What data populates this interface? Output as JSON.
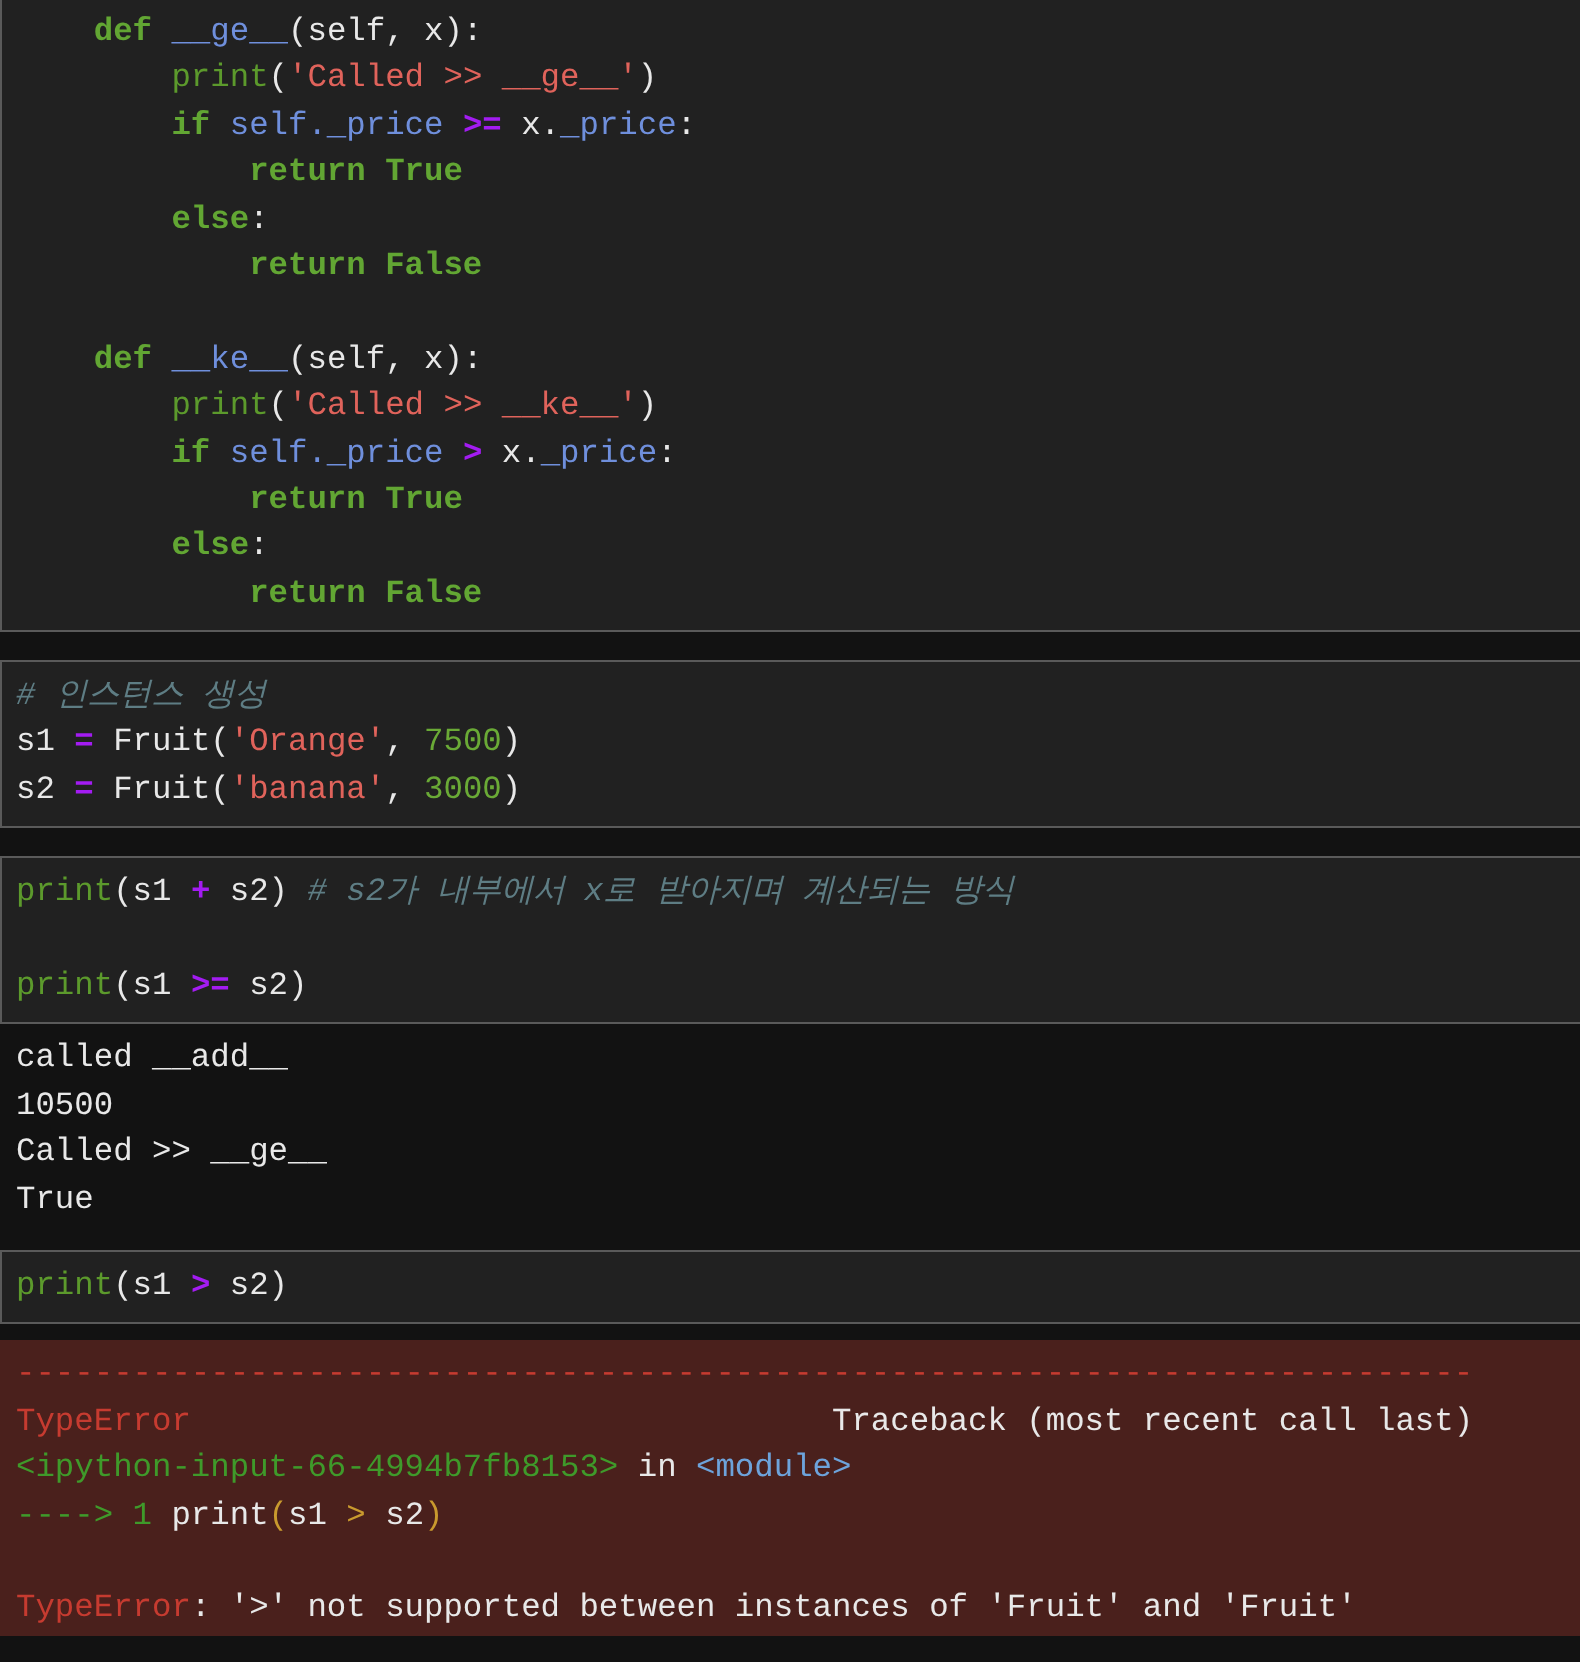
{
  "cells": [
    {
      "kind": "code",
      "lines": [
        {
          "tokens": [
            {
              "text": "    def ",
              "kind": "keyword"
            },
            {
              "text": "__ge__",
              "kind": "name"
            },
            {
              "text": "(self, x):",
              "kind": "plain"
            }
          ]
        },
        {
          "tokens": [
            {
              "text": "        print",
              "kind": "builtin"
            },
            {
              "text": "(",
              "kind": "plain"
            },
            {
              "text": "'Called >> __ge__'",
              "kind": "string"
            },
            {
              "text": ")",
              "kind": "plain"
            }
          ]
        },
        {
          "tokens": [
            {
              "text": "        if ",
              "kind": "keyword"
            },
            {
              "text": "self._price ",
              "kind": "name"
            },
            {
              "text": ">=",
              "kind": "operator"
            },
            {
              "text": " x.",
              "kind": "plain"
            },
            {
              "text": "_price",
              "kind": "name"
            },
            {
              "text": ":",
              "kind": "plain"
            }
          ]
        },
        {
          "tokens": [
            {
              "text": "            return True",
              "kind": "keyword"
            }
          ]
        },
        {
          "tokens": [
            {
              "text": "        else",
              "kind": "keyword"
            },
            {
              "text": ":",
              "kind": "plain"
            }
          ]
        },
        {
          "tokens": [
            {
              "text": "            return False",
              "kind": "keyword"
            }
          ]
        },
        {
          "space_above": true,
          "tokens": [
            {
              "text": "    def ",
              "kind": "keyword"
            },
            {
              "text": "__ke__",
              "kind": "name"
            },
            {
              "text": "(self, x):",
              "kind": "plain"
            }
          ]
        },
        {
          "tokens": [
            {
              "text": "        print",
              "kind": "builtin"
            },
            {
              "text": "(",
              "kind": "plain"
            },
            {
              "text": "'Called >> __ke__'",
              "kind": "string"
            },
            {
              "text": ")",
              "kind": "plain"
            }
          ]
        },
        {
          "tokens": [
            {
              "text": "        if ",
              "kind": "keyword"
            },
            {
              "text": "self._price ",
              "kind": "name"
            },
            {
              "text": ">",
              "kind": "operator"
            },
            {
              "text": " x.",
              "kind": "plain"
            },
            {
              "text": "_price",
              "kind": "name"
            },
            {
              "text": ":",
              "kind": "plain"
            }
          ]
        },
        {
          "tokens": [
            {
              "text": "            return True",
              "kind": "keyword"
            }
          ]
        },
        {
          "tokens": [
            {
              "text": "        else",
              "kind": "keyword"
            },
            {
              "text": ":",
              "kind": "plain"
            }
          ]
        },
        {
          "tokens": [
            {
              "text": "            return False",
              "kind": "keyword"
            }
          ]
        }
      ]
    },
    {
      "kind": "code",
      "lines": [
        {
          "tokens": [
            {
              "text": "# 인스턴스 생성",
              "kind": "comment"
            }
          ]
        },
        {
          "tokens": [
            {
              "text": "s1 ",
              "kind": "plain"
            },
            {
              "text": "=",
              "kind": "operator"
            },
            {
              "text": " Fruit(",
              "kind": "plain"
            },
            {
              "text": "'Orange'",
              "kind": "string"
            },
            {
              "text": ", ",
              "kind": "plain"
            },
            {
              "text": "7500",
              "kind": "number"
            },
            {
              "text": ")",
              "kind": "plain"
            }
          ]
        },
        {
          "tokens": [
            {
              "text": "s2 ",
              "kind": "plain"
            },
            {
              "text": "=",
              "kind": "operator"
            },
            {
              "text": " Fruit(",
              "kind": "plain"
            },
            {
              "text": "'banana'",
              "kind": "string"
            },
            {
              "text": ", ",
              "kind": "plain"
            },
            {
              "text": "3000",
              "kind": "number"
            },
            {
              "text": ")",
              "kind": "plain"
            }
          ]
        }
      ]
    },
    {
      "kind": "code",
      "lines": [
        {
          "tokens": [
            {
              "text": "print",
              "kind": "builtin"
            },
            {
              "text": "(s1 ",
              "kind": "plain"
            },
            {
              "text": "+",
              "kind": "operator"
            },
            {
              "text": " s2) ",
              "kind": "plain"
            },
            {
              "text": "# s2가 내부에서 x로 받아지며 계산되는 방식",
              "kind": "comment"
            }
          ]
        },
        {
          "space_above": true,
          "tokens": [
            {
              "text": "print",
              "kind": "builtin"
            },
            {
              "text": "(s1 ",
              "kind": "plain"
            },
            {
              "text": ">=",
              "kind": "operator"
            },
            {
              "text": " s2)",
              "kind": "plain"
            }
          ]
        }
      ],
      "outputs": [
        {
          "kind": "stream",
          "lines": [
            {
              "tokens": [
                {
                  "text": "called __add__",
                  "kind": "plain"
                }
              ]
            },
            {
              "tokens": [
                {
                  "text": "10500",
                  "kind": "plain"
                }
              ]
            },
            {
              "tokens": [
                {
                  "text": "Called >> __ge__",
                  "kind": "plain"
                }
              ]
            },
            {
              "tokens": [
                {
                  "text": "True",
                  "kind": "plain"
                }
              ]
            }
          ]
        }
      ]
    },
    {
      "kind": "code",
      "lines": [
        {
          "tokens": [
            {
              "text": "print",
              "kind": "builtin"
            },
            {
              "text": "(s1 ",
              "kind": "plain"
            },
            {
              "text": ">",
              "kind": "operator"
            },
            {
              "text": " s2)",
              "kind": "plain"
            }
          ]
        }
      ],
      "outputs": [
        {
          "kind": "error",
          "lines": [
            {
              "tokens": [
                {
                  "text": "---------------------------------------------------------------------------",
                  "kind": "error_red"
                }
              ]
            },
            {
              "tokens": [
                {
                  "text": "TypeError",
                  "kind": "error_red"
                },
                {
                  "text": "                                 Traceback (most recent call last)",
                  "kind": "plain"
                }
              ]
            },
            {
              "tokens": [
                {
                  "text": "<ipython-input-66-4994b7fb8153>",
                  "kind": "error_green"
                },
                {
                  "text": " in ",
                  "kind": "plain"
                },
                {
                  "text": "<module>",
                  "kind": "error_blue"
                }
              ]
            },
            {
              "tokens": [
                {
                  "text": "----> 1 ",
                  "kind": "error_green"
                },
                {
                  "text": "print",
                  "kind": "plain"
                },
                {
                  "text": "(",
                  "kind": "error_yellow"
                },
                {
                  "text": "s1 ",
                  "kind": "plain"
                },
                {
                  "text": ">",
                  "kind": "error_yellow"
                },
                {
                  "text": " s2",
                  "kind": "plain"
                },
                {
                  "text": ")",
                  "kind": "error_yellow"
                }
              ]
            },
            {
              "space_above": true,
              "tokens": [
                {
                  "text": "TypeError",
                  "kind": "error_red"
                },
                {
                  "text": ": '>' not supported between instances of 'Fruit' and 'Fruit'",
                  "kind": "plain"
                }
              ]
            }
          ]
        }
      ]
    }
  ]
}
